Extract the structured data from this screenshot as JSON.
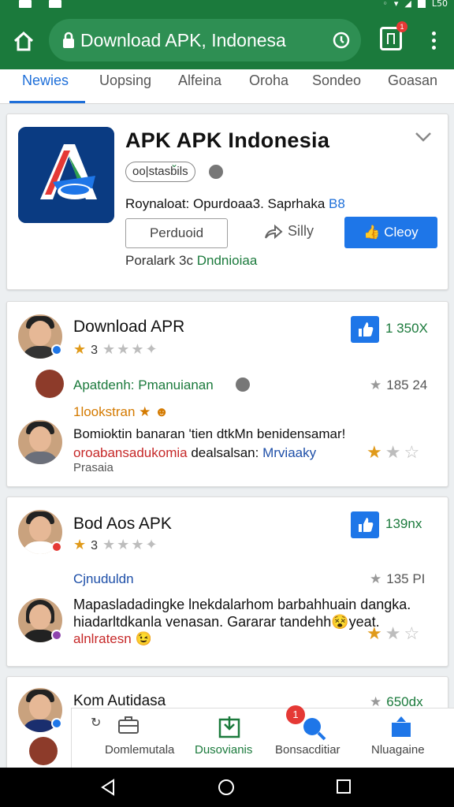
{
  "status_bar": {
    "time": "L50"
  },
  "browser": {
    "url": "Download APK, Indonesa",
    "tabs_badge": "1"
  },
  "categories": [
    {
      "label": "Newies",
      "active": true
    },
    {
      "label": "Uopsing",
      "active": false
    },
    {
      "label": "Alfeina",
      "active": false
    },
    {
      "label": "Oroha",
      "active": false
    },
    {
      "label": "Sondeo",
      "active": false
    },
    {
      "label": "Goasan",
      "active": false
    }
  ],
  "app_card": {
    "title": "APK APK Indonesia",
    "tag": "oo|stasbils",
    "meta_prefix": "Roynaloat: Opurdoaa3. Saprhaka",
    "meta_value": "B8",
    "outline_button": "Perduoid",
    "share_button": "Silly",
    "primary_button": "Cleoy",
    "footer_prefix": "Poralark 3c",
    "footer_value": "Dndnioiaa"
  },
  "reviews": [
    {
      "title": "Download APR",
      "rating_number": "3",
      "like_count": "1 350X",
      "sub_author": "Apatdenh: Pmanuianan",
      "sub_count": "185 24",
      "sub_highlight": "1lookstran",
      "body": "Bomioktin banaran 'tien dtkMn benidensamar!",
      "body2_red": "oroabansadukomia",
      "body2_mid": "dealsalsan:",
      "body2_blue": "Mrviaaky",
      "footer": "Prasaia"
    },
    {
      "title": "Bod Aos APK",
      "rating_number": "3",
      "like_count": "139nx",
      "sub_author": "Cjnuduldn",
      "sub_count": "135 PI",
      "body": "Mapasladadingke lnekdalarhom barbahhuain dangka.",
      "body_line2": "hiadarltdkanla venasan. Gararar tandehh",
      "body_line2_end": "yeat.",
      "body_red": "alnlratesn"
    },
    {
      "title": "Kom Autidasa",
      "like_count": "650dx"
    }
  ],
  "bottom_nav": [
    {
      "label": "Domlemutala",
      "icon": "briefcase-icon"
    },
    {
      "label": "Dusovianis",
      "icon": "download-icon",
      "active": true
    },
    {
      "label": "Bonsacditiar",
      "icon": "search-icon",
      "badge": "1"
    },
    {
      "label": "Nluagaine",
      "icon": "upload-icon"
    }
  ],
  "colors": {
    "brand_green": "#1b7a3c",
    "accent_blue": "#1e76e8",
    "star": "#e09a1a"
  }
}
